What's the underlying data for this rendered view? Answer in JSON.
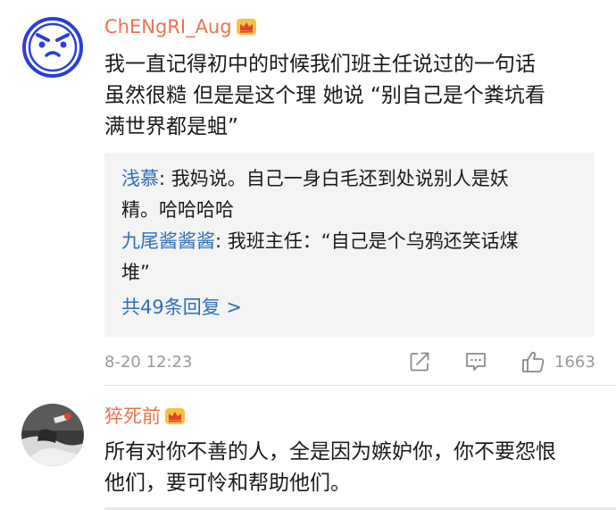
{
  "comments": [
    {
      "username": "ChENgRI_Aug",
      "text_lines": [
        "我一直记得初中的时候我们班主任说过的一句话",
        "虽然很糙 但是是这个理 她说 “别自己是个粪坑看",
        "满世界都是蛆”"
      ],
      "replies": [
        {
          "name": "浅慕",
          "text_lines": [
            ": 我妈说。自己一身白毛还到处说别人是妖",
            "精。哈哈哈哈"
          ]
        },
        {
          "name": "九尾酱酱酱",
          "text_lines": [
            ": 我班主任：“自己是个乌鸦还笑话煤",
            "堆”"
          ]
        }
      ],
      "more_replies": "共49条回复 >",
      "date": "8-20 12:23",
      "like_count": "1663",
      "icons": [
        "share-icon",
        "comment-icon",
        "like-icon",
        "crown-icon"
      ]
    },
    {
      "username": "猝死前",
      "text_lines": [
        "所有对你不善的人，全是因为嫉妒你，你不要怨恨",
        "他们，要可怜和帮助他们。"
      ]
    }
  ],
  "colors": {
    "username": "#eb7350",
    "link": "#2f6fb6",
    "meta": "#9a9a9a",
    "reply_bg": "#f4f4f4"
  }
}
